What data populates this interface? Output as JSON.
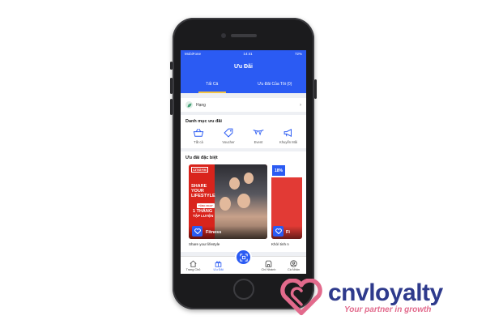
{
  "status_bar": {
    "carrier": "MobiFone",
    "time": "14:41",
    "battery": "72%"
  },
  "header": {
    "title": "Ưu Đãi"
  },
  "tabs": [
    {
      "label": "Tất Cả",
      "active": true
    },
    {
      "label": "Ưu Đãi Của Tôi (0)",
      "active": false
    }
  ],
  "rank": {
    "label": "Hạng"
  },
  "categories": {
    "title": "Danh mục ưu đãi",
    "items": [
      {
        "label": "Tất cả",
        "icon": "basket-icon"
      },
      {
        "label": "Voucher",
        "icon": "tag-icon"
      },
      {
        "label": "Event",
        "icon": "bunting-icon"
      },
      {
        "label": "Khuyến Mãi",
        "icon": "megaphone-icon"
      }
    ]
  },
  "deals": {
    "title": "Ưu đãi đặc biệt",
    "cards": [
      {
        "brand": "CITIGYM",
        "headline": "SHARE YOUR LIFESTYLE",
        "badge": "TẶNG NGAY",
        "offer_line1": "1 THÁNG",
        "offer_line2": "TẬP LUYỆN",
        "category": "Fitness",
        "caption": "Share your lifestyle"
      },
      {
        "percent": "18%",
        "category": "Fi",
        "caption": "Khởi tinh n"
      }
    ]
  },
  "bottom_nav": [
    {
      "label": "Trang Chủ",
      "icon": "home-icon",
      "active": false
    },
    {
      "label": "Ưu Đãi",
      "icon": "gift-icon",
      "active": true
    },
    {
      "label": "Chi Nhánh",
      "icon": "store-icon",
      "active": false
    },
    {
      "label": "Cá Nhân",
      "icon": "user-icon",
      "active": false
    }
  ],
  "logo": {
    "name": "cnvloyalty",
    "tagline": "Your partner in growth"
  },
  "colors": {
    "primary": "#2b5bf3",
    "accent": "#f5c542",
    "card_red": "#d9241c",
    "logo_blue": "#2e3a8c",
    "logo_pink": "#e26a8c"
  }
}
